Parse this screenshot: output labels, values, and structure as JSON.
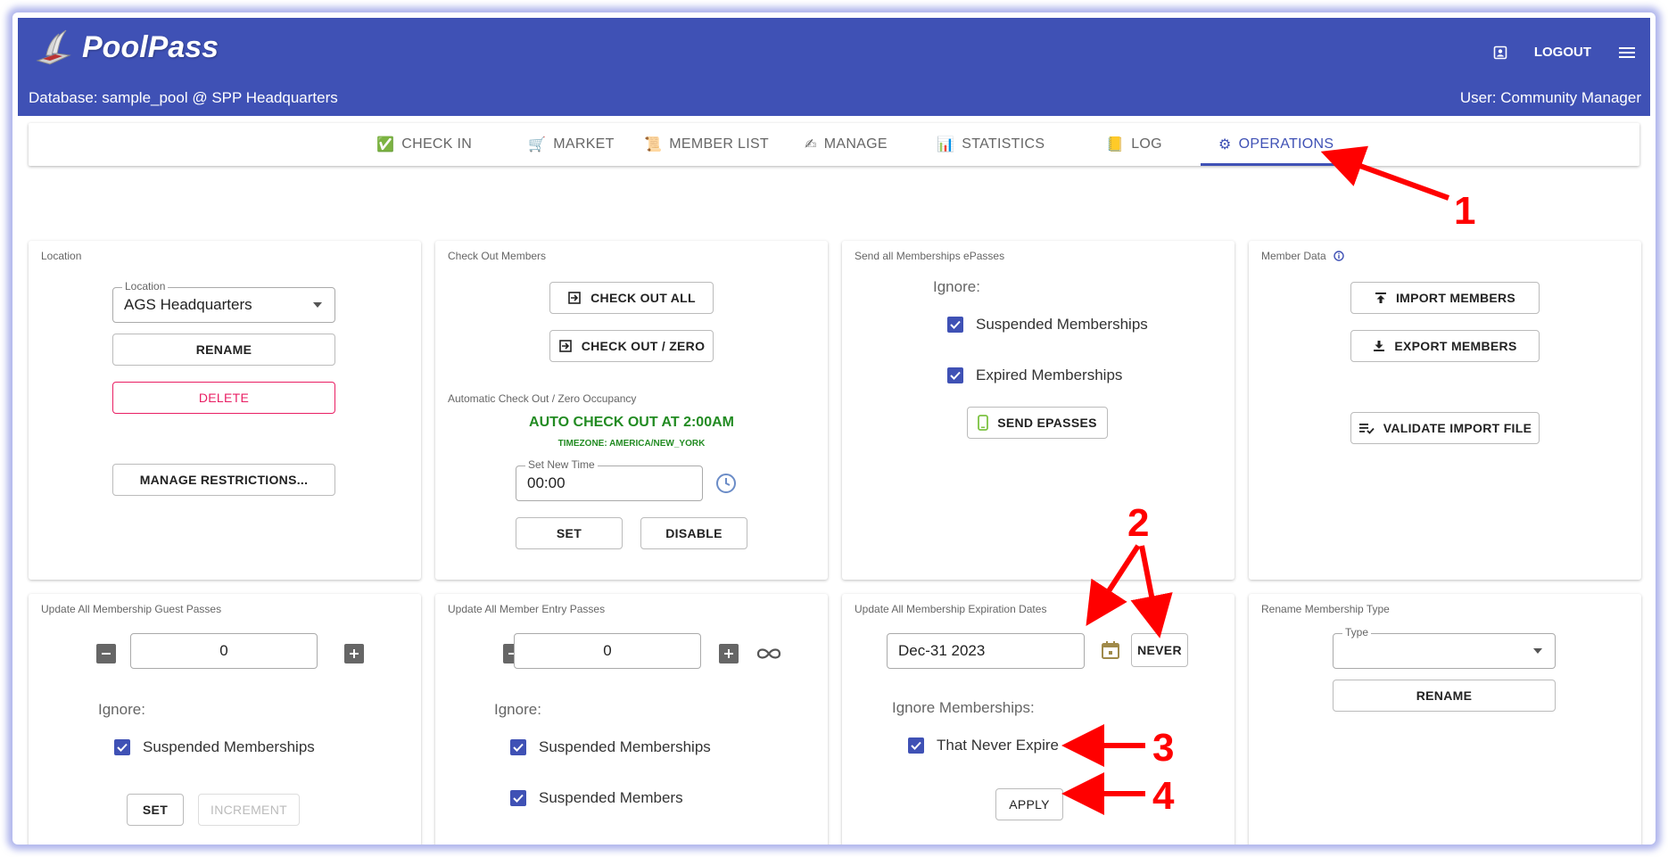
{
  "app": {
    "name": "PoolPass",
    "database_line": "Database: sample_pool @ SPP Headquarters",
    "user_line": "User: Community Manager",
    "logout_label": "LOGOUT"
  },
  "tabs": [
    {
      "label": "CHECK IN",
      "emoji": "✅"
    },
    {
      "label": "MARKET",
      "emoji": "🛒"
    },
    {
      "label": "MEMBER LIST",
      "emoji": "📜"
    },
    {
      "label": "MANAGE",
      "emoji": "✍"
    },
    {
      "label": "STATISTICS",
      "emoji": "📊"
    },
    {
      "label": "LOG",
      "emoji": "📒"
    },
    {
      "label": "OPERATIONS",
      "emoji": "⚙"
    }
  ],
  "location_panel": {
    "title": "Location",
    "field_label": "Location",
    "field_value": "AGS Headquarters",
    "rename_label": "RENAME",
    "delete_label": "DELETE",
    "restrictions_label": "MANAGE RESTRICTIONS..."
  },
  "checkout_panel": {
    "title": "Check Out Members",
    "checkout_all_label": "CHECK OUT ALL",
    "checkout_zero_label": "CHECK OUT / ZERO",
    "auto_title": "Automatic Check Out / Zero Occupancy",
    "auto_status": "AUTO CHECK OUT AT 2:00AM",
    "timezone": "TIMEZONE: AMERICA/NEW_YORK",
    "time_label": "Set New Time",
    "time_value": "00:00",
    "set_label": "SET",
    "disable_label": "DISABLE"
  },
  "epass_panel": {
    "title": "Send all Memberships ePasses",
    "ignore_label": "Ignore:",
    "opt_suspended": "Suspended Memberships",
    "opt_expired": "Expired Memberships",
    "send_label": "SEND EPASSES"
  },
  "member_data_panel": {
    "title": "Member Data",
    "import_label": "IMPORT MEMBERS",
    "export_label": "EXPORT MEMBERS",
    "validate_label": "VALIDATE IMPORT FILE"
  },
  "guest_panel": {
    "title": "Update All Membership Guest Passes",
    "value": "0",
    "ignore_label": "Ignore:",
    "opt_suspended": "Suspended Memberships",
    "set_label": "SET",
    "increment_label": "INCREMENT"
  },
  "entry_panel": {
    "title": "Update All Member Entry Passes",
    "value": "0",
    "ignore_label": "Ignore:",
    "opt_suspended_memberships": "Suspended Memberships",
    "opt_suspended_members": "Suspended Members"
  },
  "expiration_panel": {
    "title": "Update All Membership Expiration Dates",
    "date_value": "Dec-31 2023",
    "never_label": "NEVER",
    "ignore_label": "Ignore Memberships:",
    "opt_never_expire": "That Never Expire",
    "apply_label": "APPLY"
  },
  "rename_type_panel": {
    "title": "Rename Membership Type",
    "type_label": "Type",
    "type_value": "",
    "rename_label": "RENAME"
  },
  "annotations": [
    "1",
    "2",
    "3",
    "4"
  ],
  "colors": {
    "primary": "#3f51b5",
    "danger": "#e91e63",
    "success": "#228b22",
    "annotation": "#ff0000"
  }
}
